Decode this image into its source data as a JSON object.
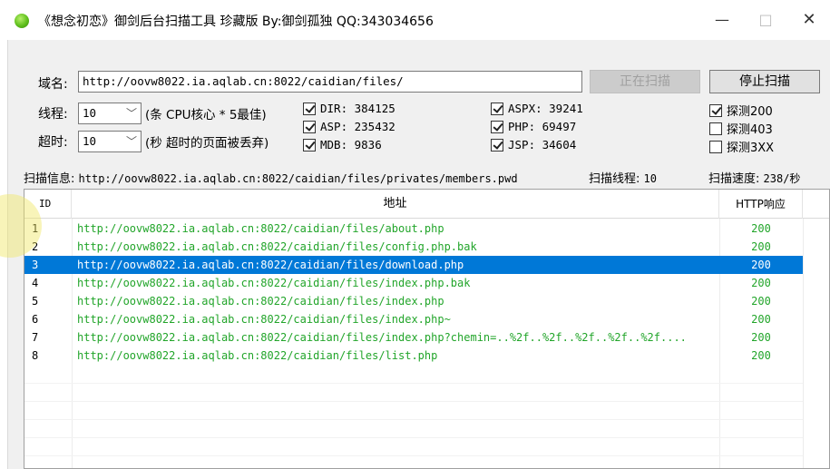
{
  "window": {
    "title": "《想念初恋》御剑后台扫描工具 珍藏版 By:御剑孤独 QQ:343034656",
    "min": "—",
    "max": "□",
    "close": "✕"
  },
  "form": {
    "domain_label": "域名:",
    "domain_value": "http://oovw8022.ia.aqlab.cn:8022/caidian/files/",
    "threads_label": "线程:",
    "threads_value": "10",
    "threads_hint": "(条 CPU核心 * 5最佳)",
    "timeout_label": "超时:",
    "timeout_value": "10",
    "timeout_hint": "(秒 超时的页面被丢弃)",
    "scan_button": "正在扫描",
    "stop_button": "停止扫描"
  },
  "dictionaries": [
    {
      "label": "DIR: 384125",
      "checked": true
    },
    {
      "label": "ASP: 235432",
      "checked": true
    },
    {
      "label": "MDB: 9836",
      "checked": true
    },
    {
      "label": "ASPX: 39241",
      "checked": true
    },
    {
      "label": "PHP: 69497",
      "checked": true
    },
    {
      "label": "JSP: 34604",
      "checked": true
    }
  ],
  "filters": [
    {
      "label": "探测200",
      "checked": true
    },
    {
      "label": "探测403",
      "checked": false
    },
    {
      "label": "探测3XX",
      "checked": false
    }
  ],
  "status": {
    "info_label": "扫描信息:",
    "info_value": "http://oovw8022.ia.aqlab.cn:8022/caidian/files/privates/members.pwd",
    "threads_label": "扫描线程:",
    "threads_value": "10",
    "speed_label": "扫描速度:",
    "speed_value": "238/秒"
  },
  "table": {
    "headers": {
      "id": "ID",
      "address": "地址",
      "code": "HTTP响应"
    },
    "rows": [
      {
        "id": "1",
        "address": "http://oovw8022.ia.aqlab.cn:8022/caidian/files/about.php",
        "code": "200"
      },
      {
        "id": "2",
        "address": "http://oovw8022.ia.aqlab.cn:8022/caidian/files/config.php.bak",
        "code": "200"
      },
      {
        "id": "3",
        "address": "http://oovw8022.ia.aqlab.cn:8022/caidian/files/download.php",
        "code": "200",
        "selected": true
      },
      {
        "id": "4",
        "address": "http://oovw8022.ia.aqlab.cn:8022/caidian/files/index.php.bak",
        "code": "200"
      },
      {
        "id": "5",
        "address": "http://oovw8022.ia.aqlab.cn:8022/caidian/files/index.php",
        "code": "200"
      },
      {
        "id": "6",
        "address": "http://oovw8022.ia.aqlab.cn:8022/caidian/files/index.php~",
        "code": "200"
      },
      {
        "id": "7",
        "address": "http://oovw8022.ia.aqlab.cn:8022/caidian/files/index.php?chemin=..%2f..%2f..%2f..%2f..%2f....",
        "code": "200"
      },
      {
        "id": "8",
        "address": "http://oovw8022.ia.aqlab.cn:8022/caidian/files/list.php",
        "code": "200"
      }
    ]
  },
  "colors": {
    "selection": "#0078d7",
    "result_text": "#22a52a"
  }
}
